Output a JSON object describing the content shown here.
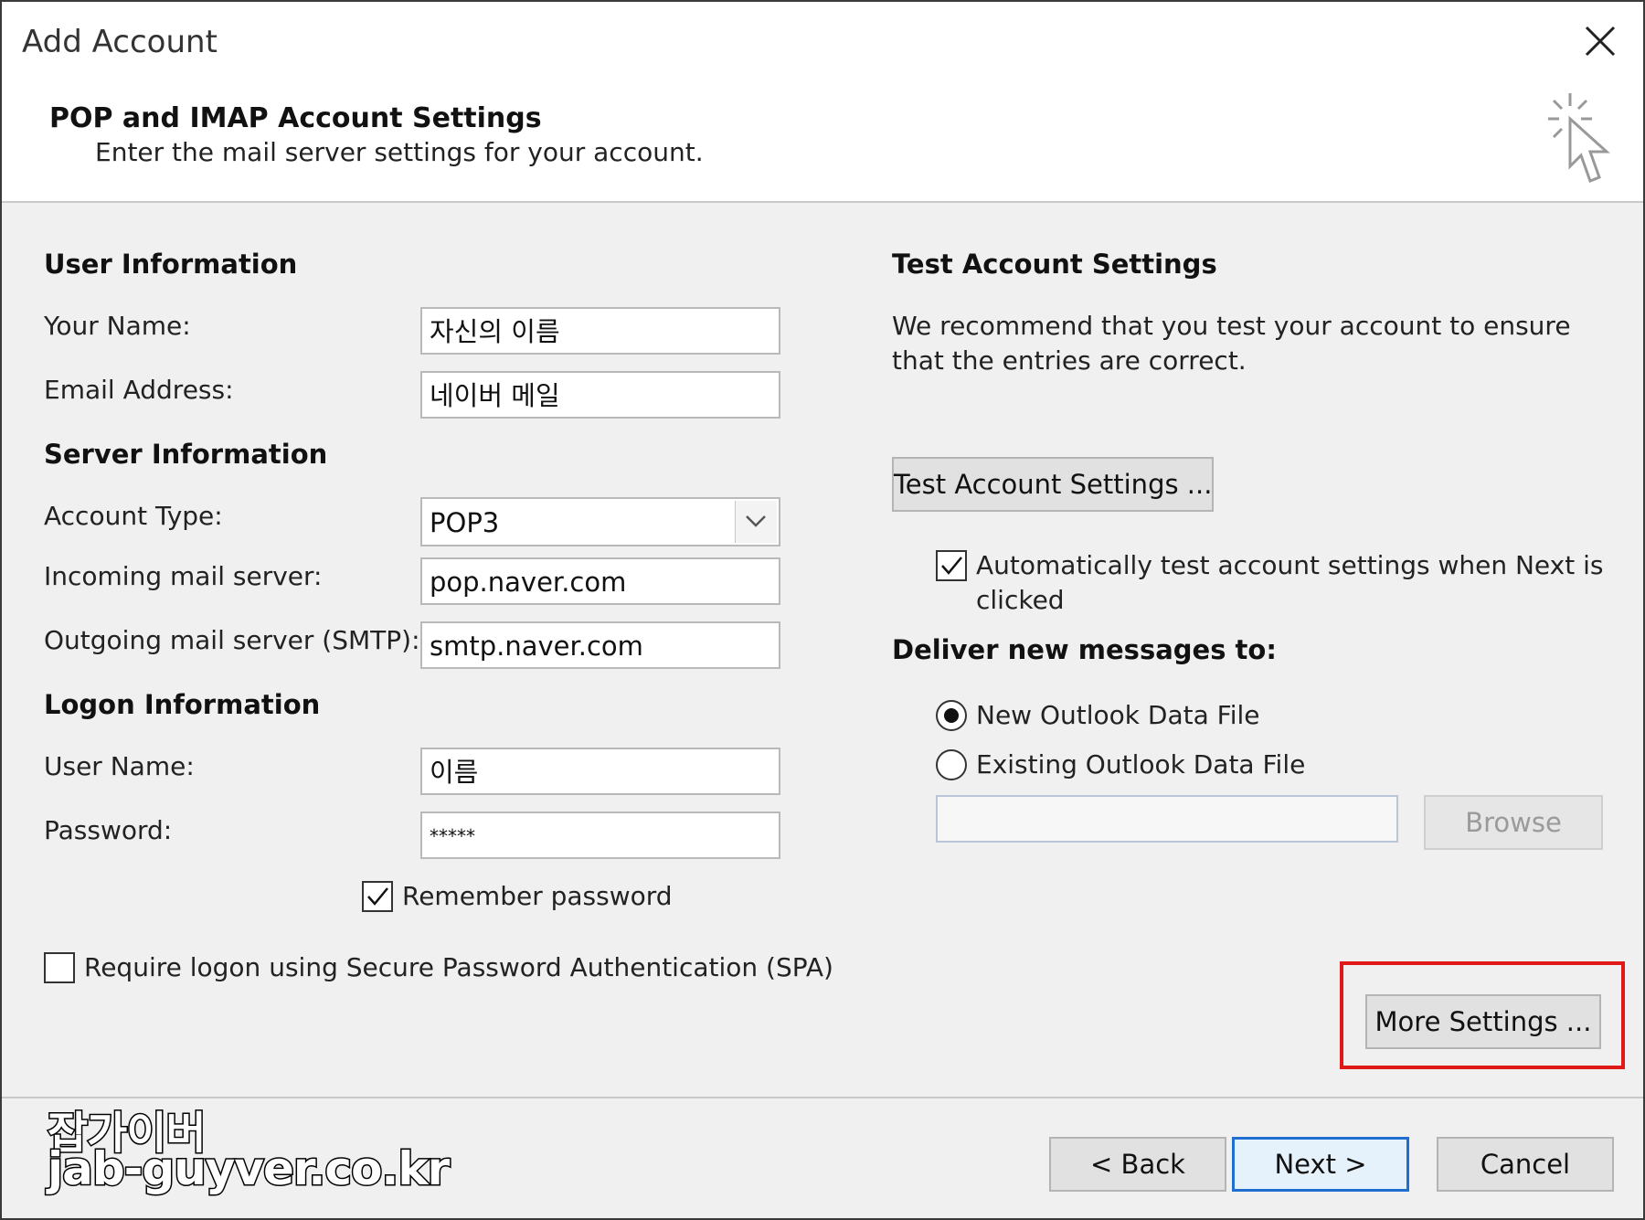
{
  "window": {
    "title": "Add Account"
  },
  "header": {
    "title": "POP and IMAP Account Settings",
    "subtitle": "Enter the mail server settings for your account."
  },
  "user_info": {
    "heading": "User Information",
    "your_name_label": "Your Name:",
    "your_name_value": "자신의 이름",
    "email_label": "Email Address:",
    "email_value": "네이버 메일"
  },
  "server_info": {
    "heading": "Server Information",
    "account_type_label": "Account Type:",
    "account_type_value": "POP3",
    "incoming_label": "Incoming mail server:",
    "incoming_value": "pop.naver.com",
    "outgoing_label": "Outgoing mail server (SMTP):",
    "outgoing_value": "smtp.naver.com"
  },
  "logon_info": {
    "heading": "Logon Information",
    "username_label": "User Name:",
    "username_value": "이름",
    "password_label": "Password:",
    "password_value": "*****",
    "remember_label": "Remember password",
    "remember_checked": true,
    "spa_label": "Require logon using Secure Password Authentication (SPA)",
    "spa_checked": false
  },
  "test": {
    "heading": "Test Account Settings",
    "description": "We recommend that you test your account to ensure that the entries are correct.",
    "button_label": "Test Account Settings ...",
    "auto_test_label_line1": "Automatically test account settings when Next is",
    "auto_test_label_line2": "clicked",
    "auto_test_checked": true
  },
  "deliver": {
    "heading": "Deliver new messages to:",
    "option_new": "New Outlook Data File",
    "option_existing": "Existing Outlook Data File",
    "selected": "New Outlook Data File",
    "browse_label": "Browse"
  },
  "more_settings_label": "More Settings ...",
  "footer": {
    "back_label": "< Back",
    "next_label": "Next >",
    "cancel_label": "Cancel"
  },
  "watermark": {
    "line1": "잡가이버",
    "line2": "jab-guyver.co.kr"
  },
  "colors": {
    "highlight": "#e01818",
    "primary_border": "#1e6fd0"
  }
}
